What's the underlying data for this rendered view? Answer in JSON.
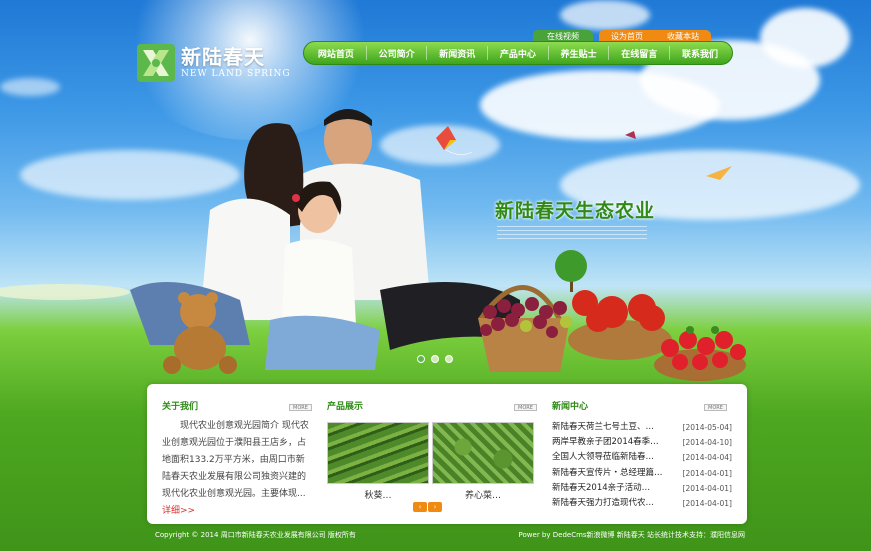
{
  "brand": {
    "name_cn": "新陆春天",
    "name_en": "NEW LAND SPRING"
  },
  "top_links": [
    "在线视频",
    "设为首页",
    "收藏本站"
  ],
  "nav": [
    "网站首页",
    "公司简介",
    "新闻资讯",
    "产品中心",
    "养生贴士",
    "在线留言",
    "联系我们"
  ],
  "banner": {
    "slogan": "新陆春天生态农业",
    "slides": 3,
    "active_slide": 1
  },
  "about": {
    "title": "关于我们",
    "more": "MORE",
    "text": "现代农业创意观光园简介 现代农业创意观光园位于濮阳县王店乡，占地面积133.2万平方米，由周口市新陆春天农业发展有限公司独资兴建的现代化农业创意观光园。主要体现...",
    "link": "详细>>"
  },
  "products": {
    "title": "产品展示",
    "more": "MORE",
    "items": [
      {
        "caption": "秋葵…"
      },
      {
        "caption": "养心菜…"
      }
    ],
    "prev": "‹",
    "next": "›"
  },
  "news": {
    "title": "新闻中心",
    "more": "MORE",
    "items": [
      {
        "title": "新陆春天荷兰七号土豆、…",
        "date": "[2014-05-04]"
      },
      {
        "title": "两岸早教亲子团2014春季…",
        "date": "[2014-04-10]"
      },
      {
        "title": "全国人大领导莅临新陆春…",
        "date": "[2014-04-04]"
      },
      {
        "title": "新陆春天宣传片・总经理篇…",
        "date": "[2014-04-01]"
      },
      {
        "title": "新陆春天2014亲子活动…",
        "date": "[2014-04-01]"
      },
      {
        "title": "新陆春天强力打造现代农…",
        "date": "[2014-04-01]"
      }
    ]
  },
  "footer": {
    "left": "Copyright © 2014 周口市新陆春天农业发展有限公司 版权所有",
    "right": "Power by DedeCms新浪微博  新陆春天  站长统计技术支持：濮阳信息网"
  },
  "colors": {
    "accent_green": "#2f8a17",
    "nav_green": "#4aa52b",
    "orange": "#f08a12"
  }
}
